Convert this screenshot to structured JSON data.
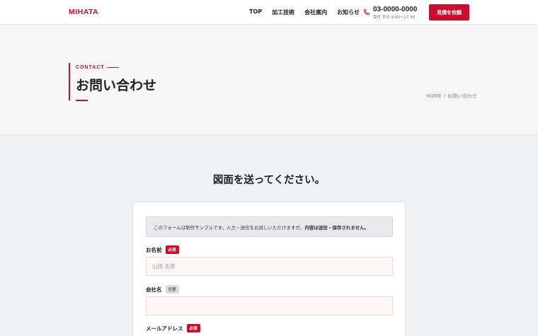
{
  "header": {
    "logo": "MIHATA",
    "nav": [
      {
        "label": "TOP"
      },
      {
        "label": "加工技術"
      },
      {
        "label": "会社案内"
      },
      {
        "label": "お知らせ"
      }
    ],
    "phone_number": "03-0000-0000",
    "phone_hours": "受付 平日 9:00〜17:30",
    "estimate_button": "見積を依頼"
  },
  "hero": {
    "eyebrow": "CONTACT",
    "title": "お問い合わせ",
    "breadcrumb": {
      "home": "HOME",
      "separator": "/",
      "current": "お問い合わせ"
    }
  },
  "section_title": "図面を送ってください。",
  "form": {
    "notice_text": "このフォームは制作サンプルです。入力・送信をお試しいただけますが、",
    "notice_strong": "内容は送信・保存されません。",
    "fields": [
      {
        "label": "お名前",
        "badge": "必須",
        "placeholder": "山田 太郎"
      },
      {
        "label": "会社名",
        "badge": "任意",
        "placeholder": ""
      },
      {
        "label": "メールアドレス",
        "badge": "必須",
        "placeholder": ""
      }
    ]
  },
  "colors": {
    "accent": "#c8102e",
    "input_bg": "#fdf7f8",
    "page_bg": "#f1f2f4"
  }
}
